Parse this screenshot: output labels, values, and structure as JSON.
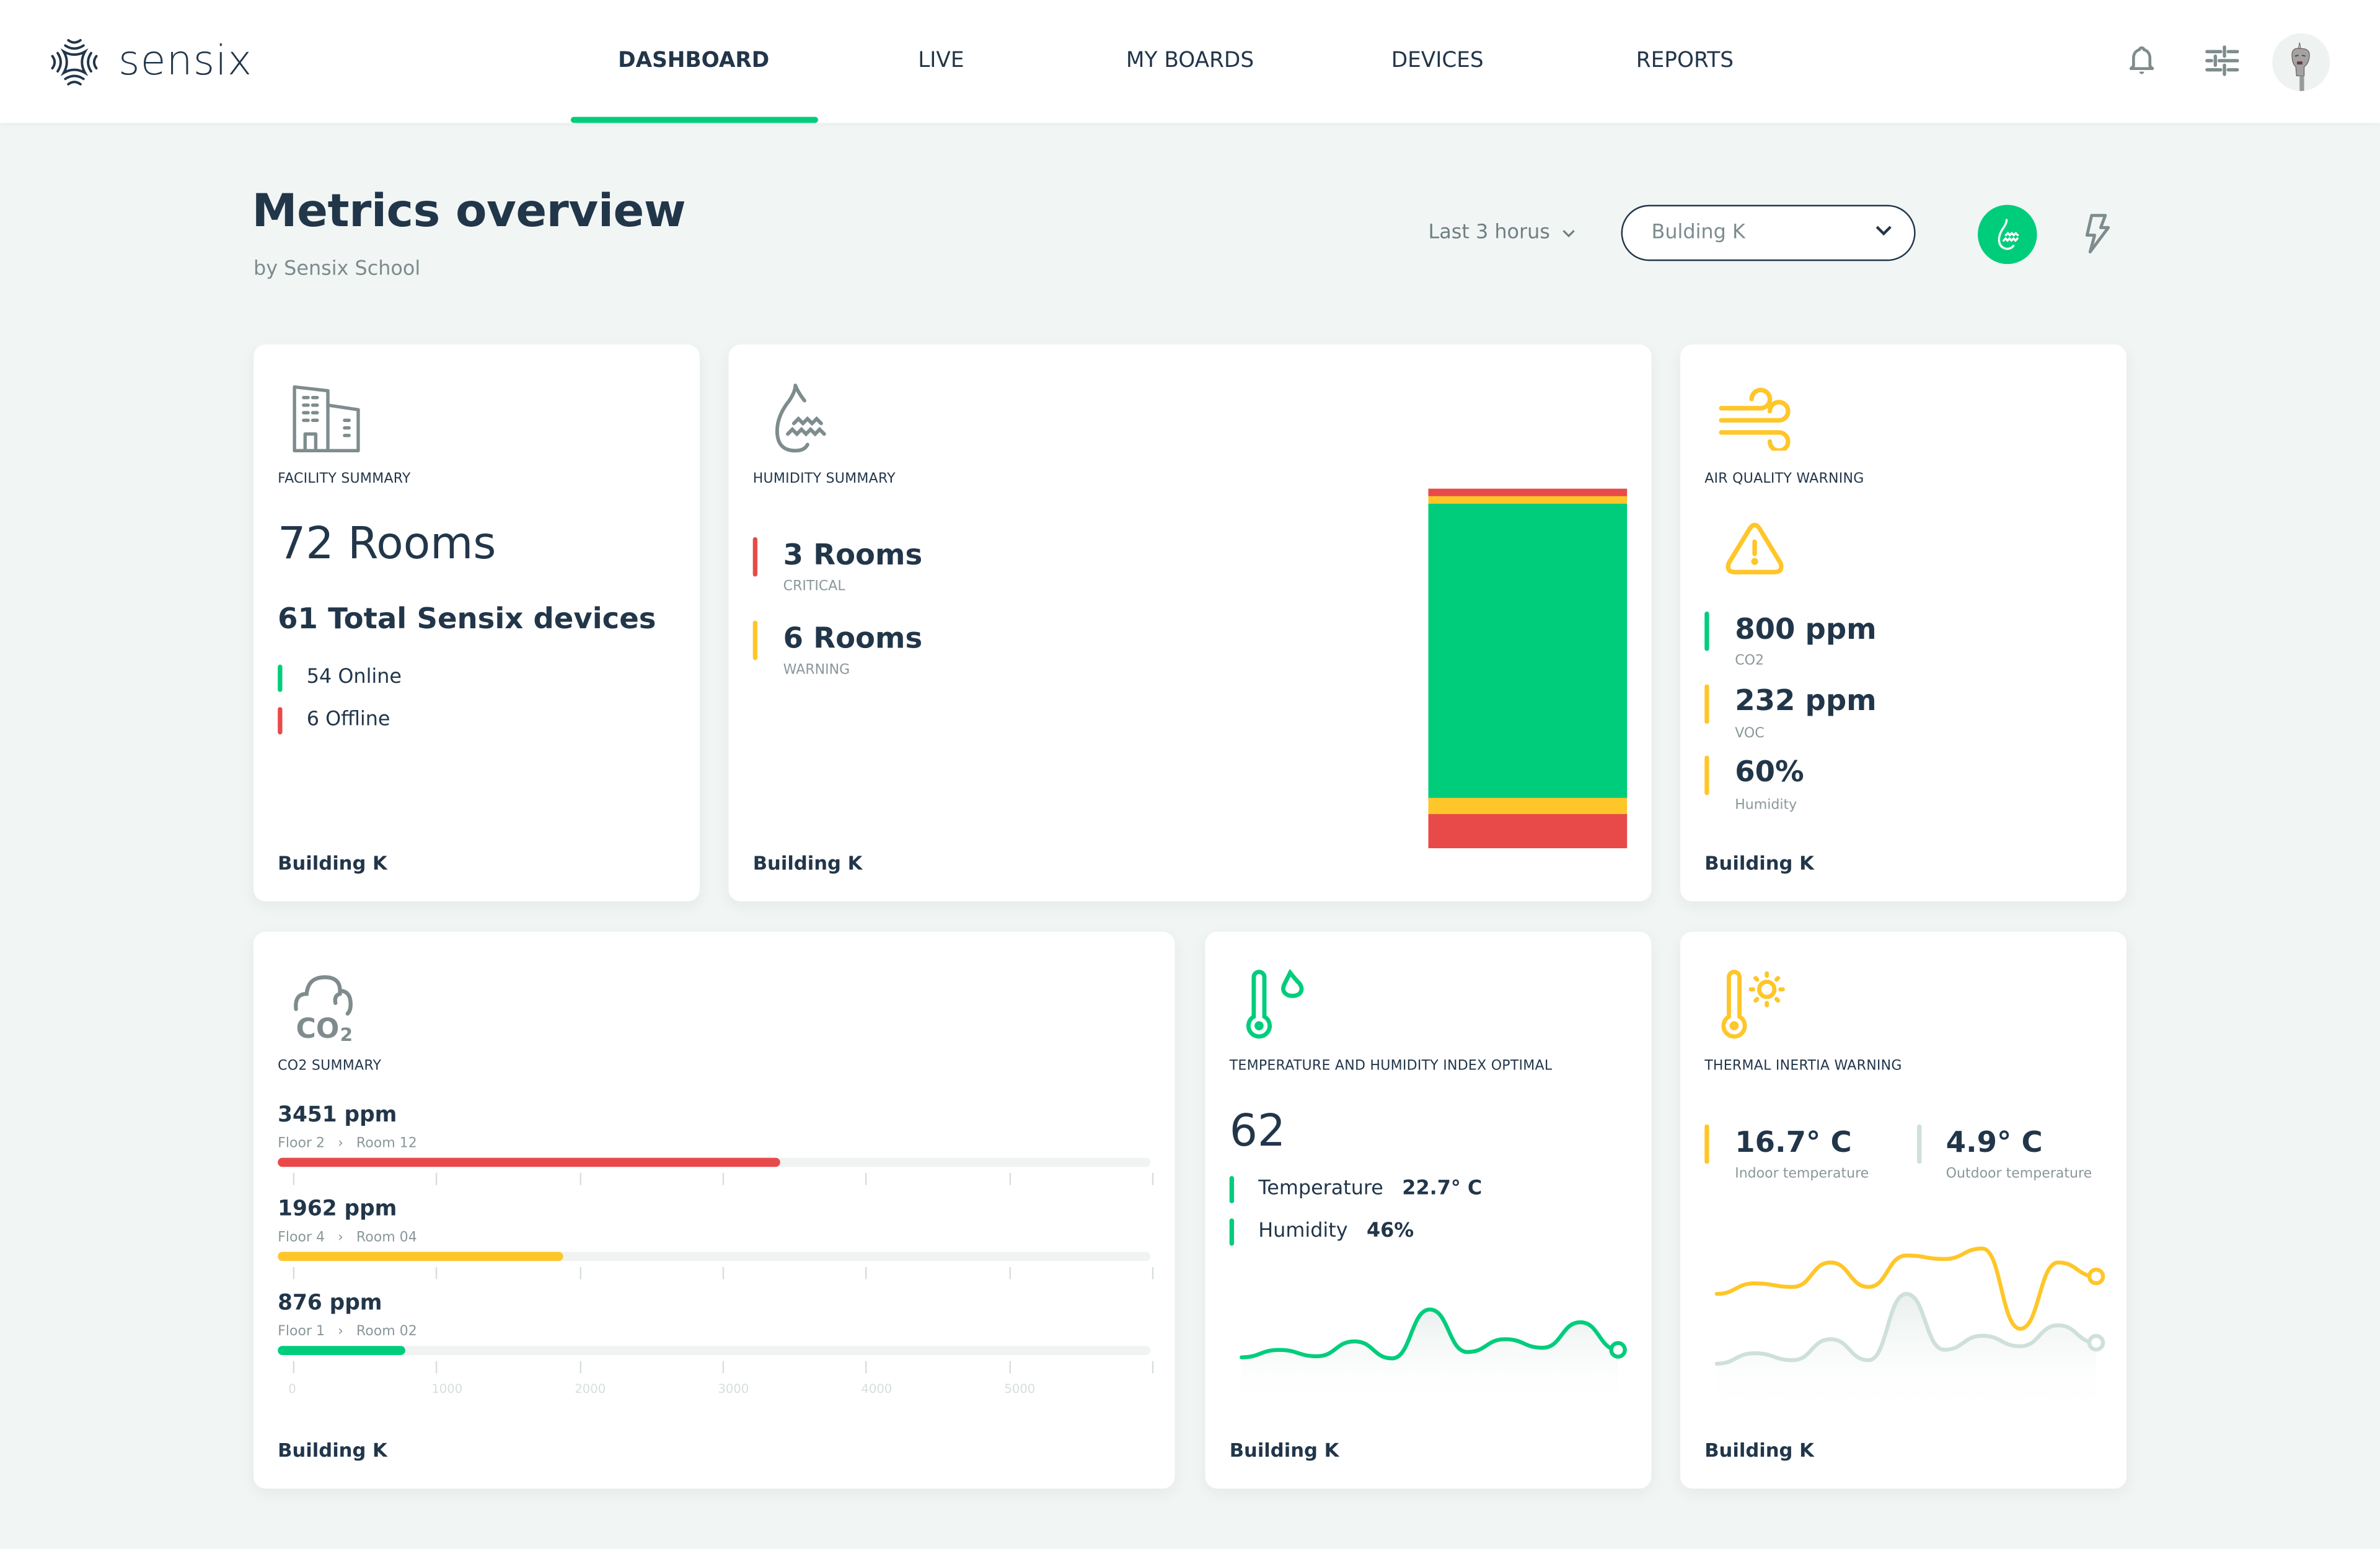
{
  "app": {
    "name": "sensix"
  },
  "nav": {
    "items": [
      {
        "label": "DASHBOARD",
        "active": true
      },
      {
        "label": "LIVE",
        "active": false
      },
      {
        "label": "MY BOARDS",
        "active": false
      },
      {
        "label": "DEVICES",
        "active": false
      },
      {
        "label": "REPORTS",
        "active": false
      }
    ],
    "icons": [
      "bell-icon",
      "sliders-icon",
      "avatar"
    ]
  },
  "page": {
    "title": "Metrics overview",
    "subtitle": "by Sensix School",
    "time_range": "Last 3 horus",
    "building_select": "Bulding K",
    "mode_icon": "humidity-icon",
    "alt_mode_icon": "lightning-icon"
  },
  "colors": {
    "accent": "#00cd7c",
    "critical": "#e84a4a",
    "warning": "#ffc629",
    "text": "#22364a",
    "muted": "#8a9799",
    "outdoor": "#cfe0da",
    "background": "#f1f5f4"
  },
  "cards": {
    "facility": {
      "label": "FACILITY SUMMARY",
      "rooms": "72 Rooms",
      "devices": "61 Total Sensix devices",
      "online": "54 Online",
      "offline": "6 Offline",
      "footer": "Building K"
    },
    "humidity": {
      "label": "HUMIDITY SUMMARY",
      "critical_value": "3 Rooms",
      "critical_label": "CRITICAL",
      "warning_value": "6 Rooms",
      "warning_label": "WARNING",
      "footer": "Building K",
      "stack": [
        {
          "status": "critical",
          "share": 0.021
        },
        {
          "status": "warning",
          "share": 0.021
        },
        {
          "status": "ok",
          "share": 0.818
        },
        {
          "status": "warning",
          "share": 0.045
        },
        {
          "status": "critical",
          "share": 0.095
        }
      ]
    },
    "air_quality": {
      "label": "AIR QUALITY WARNING",
      "metrics": [
        {
          "value": "800 ppm",
          "label": "CO2",
          "status": "ok"
        },
        {
          "value": "232 ppm",
          "label": "VOC",
          "status": "warning"
        },
        {
          "value": "60%",
          "label": "Humidity",
          "status": "warning"
        }
      ],
      "footer": "Building K"
    },
    "co2": {
      "label": "CO2 SUMMARY",
      "rows": [
        {
          "value": "3451 ppm",
          "floor": "Floor 2",
          "room": "Room 12",
          "ppm": 3451,
          "status": "critical"
        },
        {
          "value": "1962 ppm",
          "floor": "Floor 4",
          "room": "Room 04",
          "ppm": 1962,
          "status": "warning"
        },
        {
          "value": "876 ppm",
          "floor": "Floor 1",
          "room": "Room 02",
          "ppm": 876,
          "status": "ok"
        }
      ],
      "axis": {
        "min": 0,
        "max": 6000,
        "ticks": [
          "0",
          "1000",
          "2000",
          "3000",
          "4000",
          "5000",
          ""
        ]
      },
      "footer": "Building K"
    },
    "thi": {
      "label": "TEMPERATURE AND HUMIDITY INDEX OPTIMAL",
      "index": "62",
      "temperature_label": "Temperature",
      "temperature_value": "22.7° C",
      "humidity_label": "Humidity",
      "humidity_value": "46%",
      "footer": "Building K",
      "series": [
        0.35,
        0.42,
        0.36,
        0.5,
        0.34,
        0.8,
        0.4,
        0.52,
        0.44,
        0.68,
        0.42
      ]
    },
    "thermal": {
      "label": "THERMAL INERTIA WARNING",
      "indoor_value": "16.7° C",
      "indoor_label": "Indoor temperature",
      "outdoor_value": "4.9° C",
      "outdoor_label": "Outdoor temperature",
      "footer": "Building K",
      "indoor_series": [
        0.62,
        0.68,
        0.66,
        0.8,
        0.66,
        0.84,
        0.82,
        0.88,
        0.42,
        0.8,
        0.72
      ],
      "outdoor_series": [
        0.22,
        0.28,
        0.24,
        0.36,
        0.24,
        0.62,
        0.3,
        0.38,
        0.32,
        0.44,
        0.34
      ]
    }
  }
}
